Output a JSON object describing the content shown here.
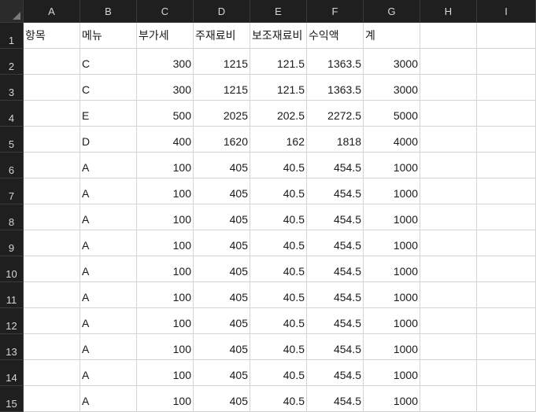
{
  "columns": [
    "A",
    "B",
    "C",
    "D",
    "E",
    "F",
    "G",
    "H",
    "I"
  ],
  "rows": [
    "1",
    "2",
    "3",
    "4",
    "5",
    "6",
    "7",
    "8",
    "9",
    "10",
    "11",
    "12",
    "13",
    "14",
    "15"
  ],
  "headers": {
    "A": "항목",
    "B": "메뉴",
    "C": "부가세",
    "D": "주재료비",
    "E": "보조재료비",
    "F": "수익액",
    "G": "계"
  },
  "data_rows": [
    {
      "menu": "C",
      "vat": "300",
      "main": "1215",
      "sub": "121.5",
      "profit": "1363.5",
      "total": "3000"
    },
    {
      "menu": "C",
      "vat": "300",
      "main": "1215",
      "sub": "121.5",
      "profit": "1363.5",
      "total": "3000"
    },
    {
      "menu": "E",
      "vat": "500",
      "main": "2025",
      "sub": "202.5",
      "profit": "2272.5",
      "total": "5000"
    },
    {
      "menu": "D",
      "vat": "400",
      "main": "1620",
      "sub": "162",
      "profit": "1818",
      "total": "4000"
    },
    {
      "menu": "A",
      "vat": "100",
      "main": "405",
      "sub": "40.5",
      "profit": "454.5",
      "total": "1000"
    },
    {
      "menu": "A",
      "vat": "100",
      "main": "405",
      "sub": "40.5",
      "profit": "454.5",
      "total": "1000"
    },
    {
      "menu": "A",
      "vat": "100",
      "main": "405",
      "sub": "40.5",
      "profit": "454.5",
      "total": "1000"
    },
    {
      "menu": "A",
      "vat": "100",
      "main": "405",
      "sub": "40.5",
      "profit": "454.5",
      "total": "1000"
    },
    {
      "menu": "A",
      "vat": "100",
      "main": "405",
      "sub": "40.5",
      "profit": "454.5",
      "total": "1000"
    },
    {
      "menu": "A",
      "vat": "100",
      "main": "405",
      "sub": "40.5",
      "profit": "454.5",
      "total": "1000"
    },
    {
      "menu": "A",
      "vat": "100",
      "main": "405",
      "sub": "40.5",
      "profit": "454.5",
      "total": "1000"
    },
    {
      "menu": "A",
      "vat": "100",
      "main": "405",
      "sub": "40.5",
      "profit": "454.5",
      "total": "1000"
    },
    {
      "menu": "A",
      "vat": "100",
      "main": "405",
      "sub": "40.5",
      "profit": "454.5",
      "total": "1000"
    },
    {
      "menu": "A",
      "vat": "100",
      "main": "405",
      "sub": "40.5",
      "profit": "454.5",
      "total": "1000"
    }
  ]
}
